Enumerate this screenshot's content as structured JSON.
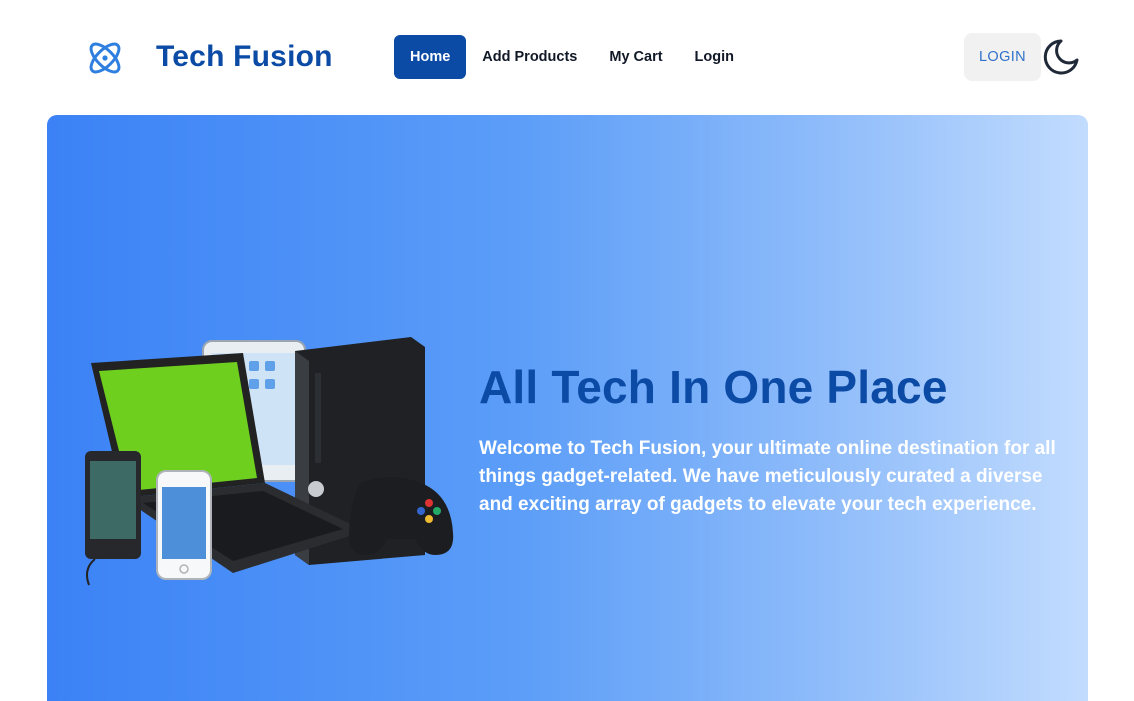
{
  "brand": {
    "name": "Tech Fusion",
    "logo_icon": "atom-logo-icon",
    "color": "#0b4aa5"
  },
  "nav": {
    "links": [
      {
        "label": "Home",
        "active": true
      },
      {
        "label": "Add Products",
        "active": false
      },
      {
        "label": "My Cart",
        "active": false
      },
      {
        "label": "Login",
        "active": false
      }
    ]
  },
  "actions": {
    "login_label": "LOGIN",
    "theme_icon": "moon-icon"
  },
  "hero": {
    "title": "All Tech In One Place",
    "description": "Welcome to Tech Fusion, your ultimate online destination for all things gadget-related. We have meticulously curated a diverse and exciting array of gadgets to elevate your tech experience.",
    "image_icon": "gadgets-illustration",
    "gradient": [
      "#3b82f6",
      "#c2dcfe"
    ]
  },
  "colors": {
    "primary": "#0b4aa5",
    "accent": "#2f72c9",
    "button_bg": "#f1f1f1"
  }
}
